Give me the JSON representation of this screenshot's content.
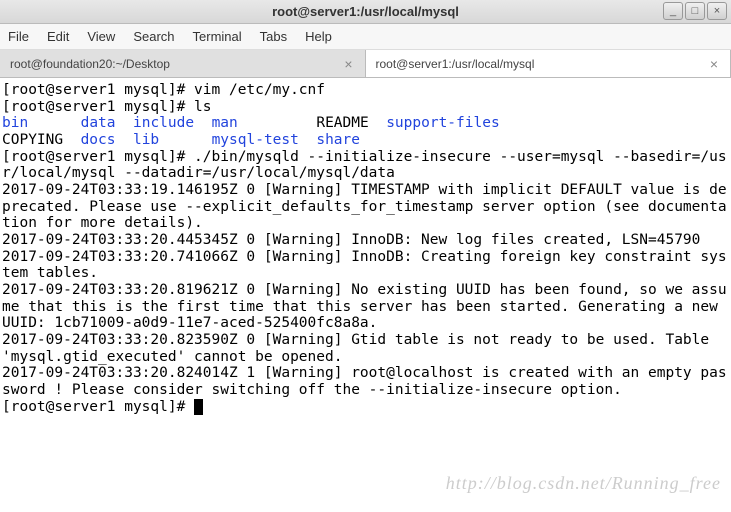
{
  "window": {
    "title": "root@server1:/usr/local/mysql",
    "buttons": {
      "min": "_",
      "max": "□",
      "close": "×"
    }
  },
  "menu": {
    "file": "File",
    "edit": "Edit",
    "view": "View",
    "search": "Search",
    "terminal": "Terminal",
    "tabs": "Tabs",
    "help": "Help"
  },
  "tabs": [
    {
      "label": "root@foundation20:~/Desktop",
      "active": false
    },
    {
      "label": "root@server1:/usr/local/mysql",
      "active": true
    }
  ],
  "term": {
    "p1": "[root@server1 mysql]# vim /etc/my.cnf",
    "p2": "[root@server1 mysql]# ls",
    "ls": {
      "bin": "bin",
      "data": "data",
      "include": "include",
      "man": "man",
      "readme": "README",
      "support": "support-files",
      "copying": "COPYING",
      "docs": "docs",
      "lib": "lib",
      "mysqltest": "mysql-test",
      "share": "share"
    },
    "cmd": "[root@server1 mysql]# ./bin/mysqld --initialize-insecure --user=mysql --basedir=/usr/local/mysql --datadir=/usr/local/mysql/data",
    "l1": "2017-09-24T03:33:19.146195Z 0 [Warning] TIMESTAMP with implicit DEFAULT value is deprecated. Please use --explicit_defaults_for_timestamp server option (see documentation for more details).",
    "l2": "2017-09-24T03:33:20.445345Z 0 [Warning] InnoDB: New log files created, LSN=45790",
    "l3": "2017-09-24T03:33:20.741066Z 0 [Warning] InnoDB: Creating foreign key constraint system tables.",
    "l4": "2017-09-24T03:33:20.819621Z 0 [Warning] No existing UUID has been found, so we assume that this is the first time that this server has been started. Generating a new UUID: 1cb71009-a0d9-11e7-aced-525400fc8a8a.",
    "l5": "2017-09-24T03:33:20.823590Z 0 [Warning] Gtid table is not ready to be used. Table 'mysql.gtid_executed' cannot be opened.",
    "l6": "2017-09-24T03:33:20.824014Z 1 [Warning] root@localhost is created with an empty password ! Please consider switching off the --initialize-insecure option.",
    "p3": "[root@server1 mysql]# "
  },
  "watermark": "http://blog.csdn.net/Running_free"
}
